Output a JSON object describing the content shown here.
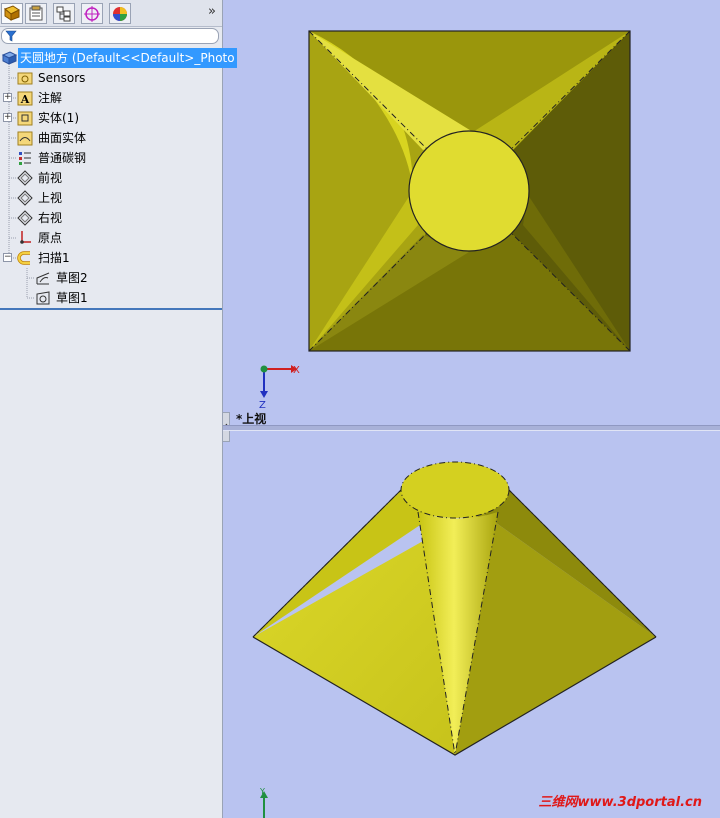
{
  "tree": {
    "root": "天圆地方  (Default<<Default>_Photo",
    "items": [
      {
        "label": "Sensors"
      },
      {
        "label": "注解"
      },
      {
        "label": "实体(1)"
      },
      {
        "label": "曲面实体"
      },
      {
        "label": "普通碳钢"
      },
      {
        "label": "前视"
      },
      {
        "label": "上视"
      },
      {
        "label": "右视"
      },
      {
        "label": "原点"
      },
      {
        "label": "扫描1"
      },
      {
        "label": "草图2"
      },
      {
        "label": "草图1"
      }
    ]
  },
  "tabs": {
    "more": "»"
  },
  "viewport": {
    "top_view_label": "*上视",
    "axis_x": "X",
    "axis_z": "Z",
    "axis_y": "Y"
  },
  "watermark": "三维网www.3dportal.cn"
}
